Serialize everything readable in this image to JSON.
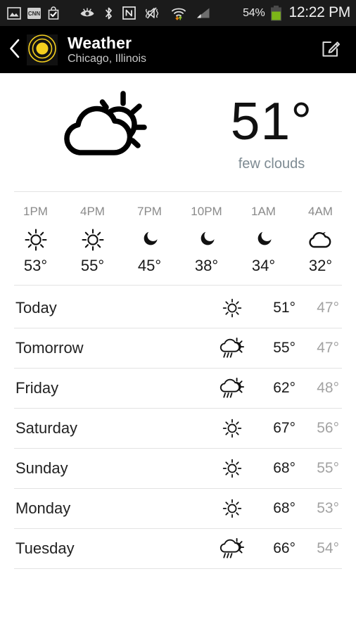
{
  "statusbar": {
    "left_icons": [
      "image-icon",
      "cnn-icon",
      "shopping-bag-check-icon"
    ],
    "mid_icons": [
      "smart-stay-eye-icon",
      "bluetooth-icon",
      "nfc-icon",
      "sound-mute-vibrate-icon",
      "wifi-transfer-icon",
      "cellular-signal-icon"
    ],
    "battery_percent": "54%",
    "clock": "12:22 PM",
    "battery_color": "#7cb518"
  },
  "actionbar": {
    "back_icon": "back-chevron-icon",
    "app_icon": "weather-radar-sun-icon",
    "app_icon_color": "#f4cf1e",
    "title": "Weather",
    "subtitle": "Chicago, Illinois",
    "edit_icon": "edit-compose-icon"
  },
  "current": {
    "icon": "partly-cloudy-day-icon",
    "temperature": "51°",
    "description": "few clouds"
  },
  "hourly": [
    {
      "time": "1PM",
      "icon": "sun-icon",
      "temp": "53°"
    },
    {
      "time": "4PM",
      "icon": "sun-icon",
      "temp": "55°"
    },
    {
      "time": "7PM",
      "icon": "moon-icon",
      "temp": "45°"
    },
    {
      "time": "10PM",
      "icon": "moon-icon",
      "temp": "38°"
    },
    {
      "time": "1AM",
      "icon": "moon-icon",
      "temp": "34°"
    },
    {
      "time": "4AM",
      "icon": "cloudy-night-icon",
      "temp": "32°"
    }
  ],
  "daily": [
    {
      "day": "Today",
      "icon": "sun-icon",
      "high": "51°",
      "low": "47°"
    },
    {
      "day": "Tomorrow",
      "icon": "sun-shower-icon",
      "high": "55°",
      "low": "47°"
    },
    {
      "day": "Friday",
      "icon": "sun-shower-icon",
      "high": "62°",
      "low": "48°"
    },
    {
      "day": "Saturday",
      "icon": "sun-icon",
      "high": "67°",
      "low": "56°"
    },
    {
      "day": "Sunday",
      "icon": "sun-icon",
      "high": "68°",
      "low": "55°"
    },
    {
      "day": "Monday",
      "icon": "sun-icon",
      "high": "68°",
      "low": "53°"
    },
    {
      "day": "Tuesday",
      "icon": "sun-shower-icon",
      "high": "66°",
      "low": "54°"
    }
  ]
}
